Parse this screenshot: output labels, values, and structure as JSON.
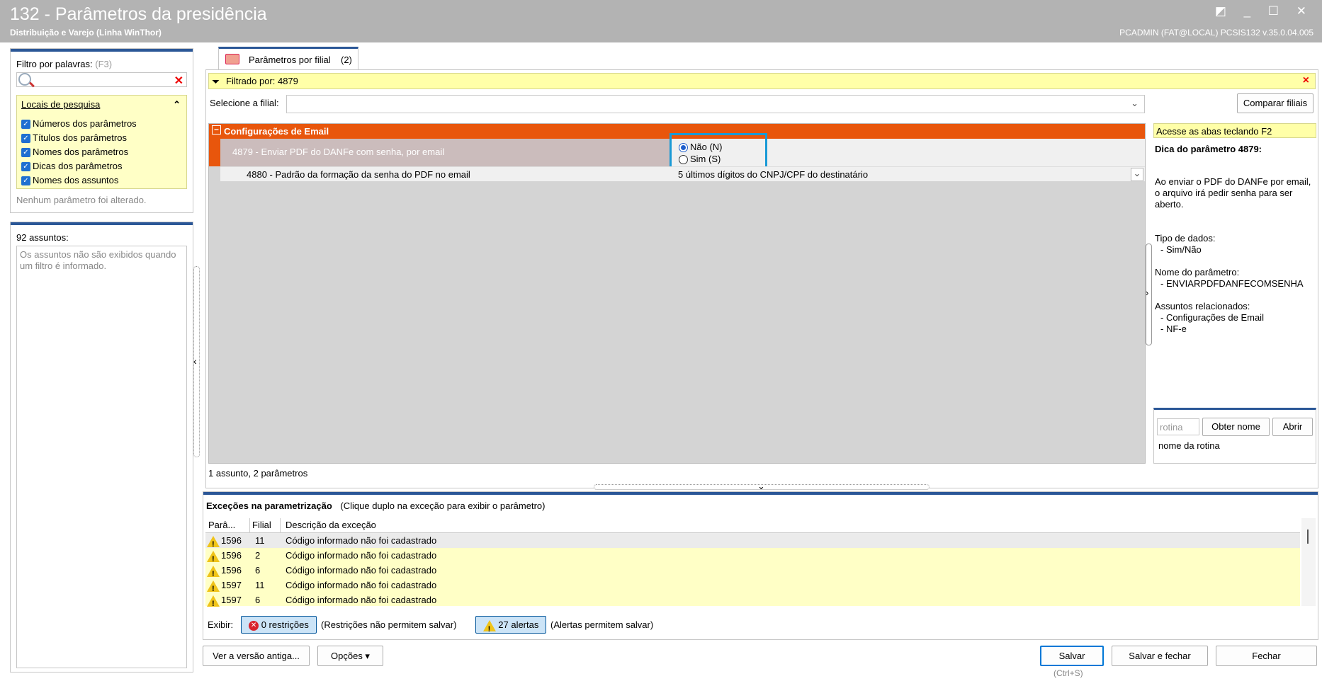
{
  "window": {
    "title": "132 - Parâmetros da presidência",
    "subtitle": "Distribuição e Varejo (Linha WinThor)",
    "user_info": "PCADMIN (FAT@LOCAL)   PCSIS132  v.35.0.04.005",
    "controls": "◩ _ ☐ ✕"
  },
  "filter_panel": {
    "label": "Filtro por palavras:",
    "shortcut": "(F3)",
    "search_value": "",
    "clear_icon": "✕",
    "locations_title": "Locais de pesquisa",
    "collapse_icon": "⌃",
    "options": [
      "Números dos parâmetros",
      "Títulos dos parâmetros",
      "Nomes dos parâmetros",
      "Dicas dos parâmetros",
      "Nomes dos assuntos"
    ],
    "status": "Nenhum parâmetro foi alterado."
  },
  "subjects_panel": {
    "title": "92 assuntos:",
    "message": "Os assuntos não são exibidos quando um filtro é informado."
  },
  "tab": {
    "label": "Parâmetros por filial",
    "count": "(2)"
  },
  "filter_bar": {
    "text": "Filtrado por: 4879",
    "close": "×"
  },
  "branch": {
    "label": "Selecione a filial:",
    "value": "",
    "compare_button": "Comparar filiais"
  },
  "group": {
    "toggle": "−",
    "title": "Configurações de Email"
  },
  "params": [
    {
      "label": "4879 - Enviar PDF do DANFe com senha, por email",
      "options": [
        "Não (N)",
        "Sim (S)"
      ],
      "selected": "Não (N)"
    },
    {
      "label": "4880 - Padrão da formação da senha do PDF no email",
      "value": "5 últimos dígitos do CNPJ/CPF do destinatário"
    }
  ],
  "summary": "1 assunto, 2 parâmetros",
  "tip": {
    "hint": "Acesse as abas teclando F2",
    "title": "Dica do parâmetro 4879:",
    "text": "Ao enviar o PDF do DANFe por email, o arquivo irá pedir senha para ser aberto.",
    "type_label": "Tipo de dados:",
    "type_value": "- Sim/Não",
    "name_label": "Nome do parâmetro:",
    "name_value": "- ENVIARPDFDANFECOMSENHA",
    "subjects_label": "Assuntos relacionados:",
    "subjects": [
      "- Configurações de Email",
      "- NF-e"
    ],
    "rotina_placeholder": "rotina",
    "obter_button": "Obter nome",
    "abrir_button": "Abrir",
    "rotina_label": "nome da rotina"
  },
  "exceptions": {
    "title": "Exceções na parametrização",
    "hint": "(Clique duplo na exceção para exibir o parâmetro)",
    "columns": [
      "Parâ...",
      "Filial",
      "Descrição da exceção"
    ],
    "rows": [
      {
        "param": "1596",
        "filial": "11",
        "desc": "Código informado não foi cadastrado"
      },
      {
        "param": "1596",
        "filial": "2",
        "desc": "Código informado não foi cadastrado"
      },
      {
        "param": "1596",
        "filial": "6",
        "desc": "Código informado não foi cadastrado"
      },
      {
        "param": "1597",
        "filial": "11",
        "desc": "Código informado não foi cadastrado"
      },
      {
        "param": "1597",
        "filial": "6",
        "desc": "Código informado não foi cadastrado"
      }
    ],
    "show_label": "Exibir:",
    "restrictions_button": "0 restrições",
    "restrictions_note": "(Restrições não permitem salvar)",
    "alerts_button": "27 alertas",
    "alerts_note": "(Alertas permitem salvar)"
  },
  "footer": {
    "old_version": "Ver a versão antiga...",
    "options": "Opções ▾",
    "save": "Salvar",
    "save_shortcut": "(Ctrl+S)",
    "save_close": "Salvar e fechar",
    "close": "Fechar"
  },
  "colors": {
    "accent_blue": "#2b5797",
    "group_orange": "#e8560c",
    "highlight_blue": "#1a9ad6",
    "title_gray": "#b3b3b3"
  }
}
